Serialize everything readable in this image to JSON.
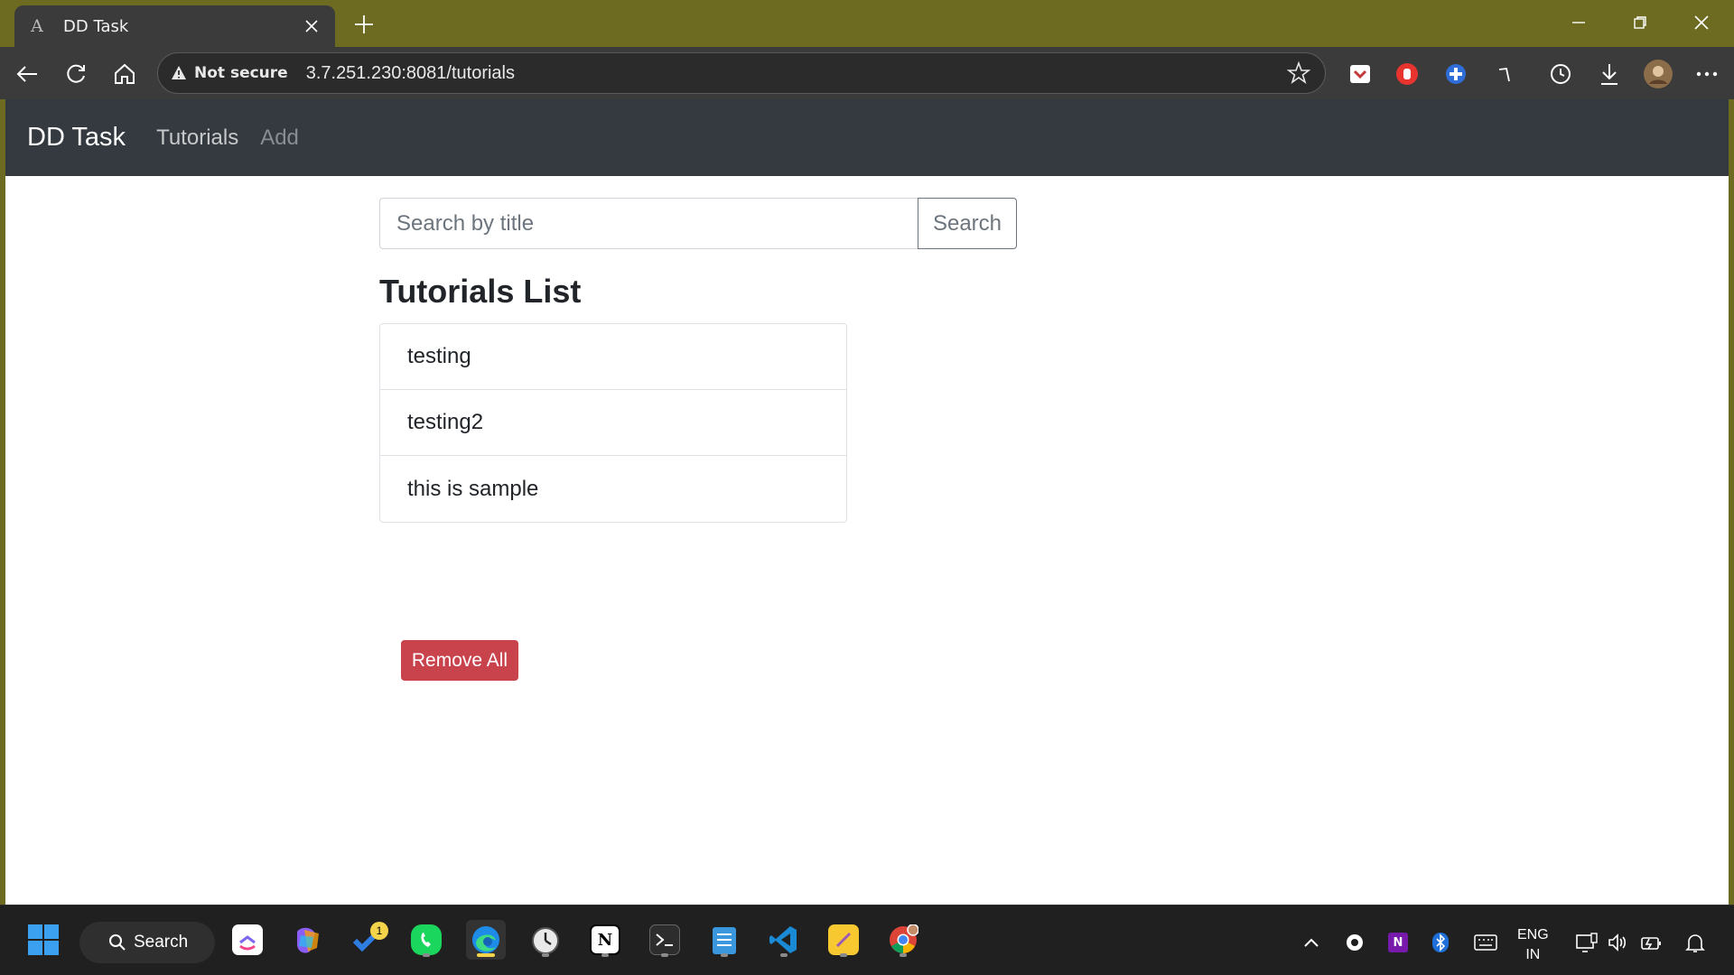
{
  "browser": {
    "tab_title": "DD Task",
    "tab_favicon": "A",
    "security_label": "Not secure",
    "url": "3.7.251.230:8081/tutorials"
  },
  "navbar": {
    "brand": "DD Task",
    "links": [
      "Tutorials",
      "Add"
    ]
  },
  "search": {
    "placeholder": "Search by title",
    "value": "",
    "button_label": "Search"
  },
  "tutorials": {
    "title": "Tutorials List",
    "items": [
      "testing",
      "testing2",
      "this is sample"
    ],
    "remove_all_label": "Remove All"
  },
  "taskbar": {
    "search_label": "Search",
    "todo_badge": "1",
    "lang_line1": "ENG",
    "lang_line2": "IN",
    "apps": [
      "clickup-icon",
      "copilot-icon",
      "todo-icon",
      "phone-link-icon",
      "edge-icon",
      "clock-icon",
      "notion-icon",
      "terminal-icon",
      "notepad-icon",
      "vscode-icon",
      "sticky-notes-icon",
      "chrome-icon"
    ]
  },
  "colors": {
    "titlebar": "#6d6a21",
    "navbar": "#343a40",
    "danger": "#c9434d"
  }
}
